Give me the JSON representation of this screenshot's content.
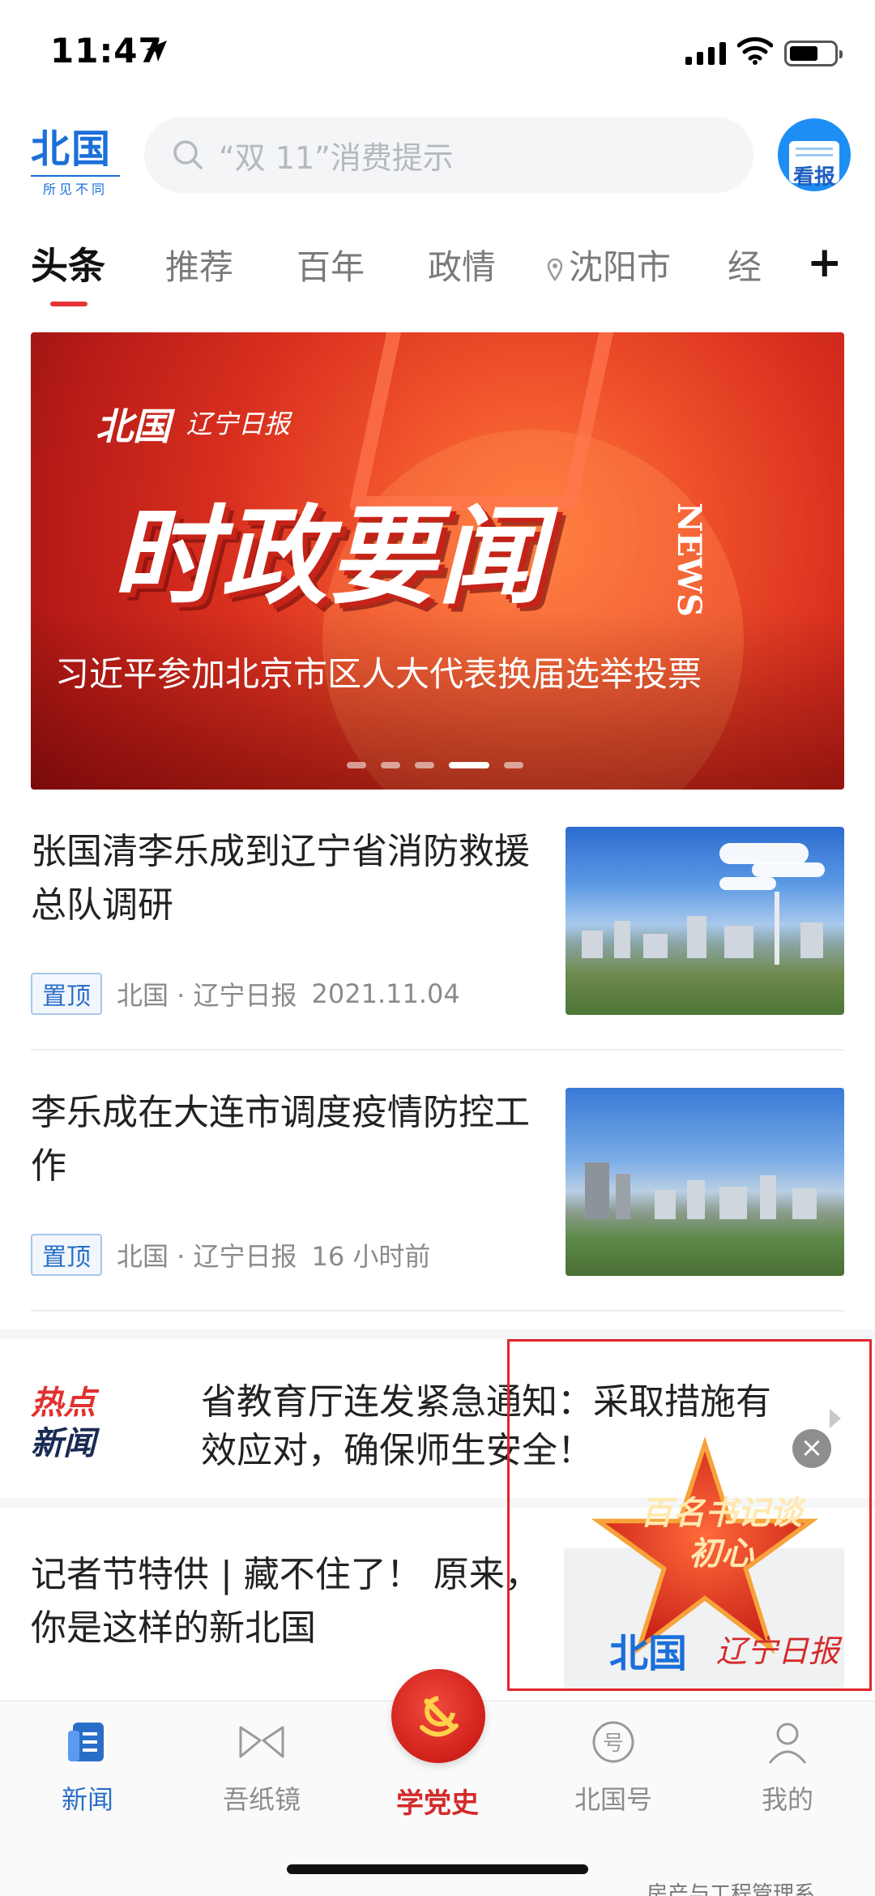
{
  "status_bar": {
    "time": "11:47"
  },
  "header": {
    "logo_text": "北国",
    "logo_slogan": "所见不同",
    "search_placeholder": "“双 11”消费提示",
    "kanbao_label": "看报"
  },
  "tabs": [
    {
      "label": "头条",
      "active": true
    },
    {
      "label": "推荐"
    },
    {
      "label": "百年"
    },
    {
      "label": "政情"
    },
    {
      "label": "沈阳市",
      "icon": "location-pin-icon"
    },
    {
      "label": "经"
    }
  ],
  "banner": {
    "brand": "北国",
    "brand2": "辽宁日报",
    "title": "时政要闻",
    "news_tag": "NEWS",
    "caption": "习近平参加北京市区人大代表换届选举投票",
    "dots_total": 5,
    "dots_active_index": 3
  },
  "news": [
    {
      "title": "张国清李乐成到辽宁省消防救援总队调研",
      "badge": "置顶",
      "source": "北国 · 辽宁日报",
      "time": "2021.11.04"
    },
    {
      "title": "李乐成在大连市调度疫情防控工作",
      "badge": "置顶",
      "source": "北国 · 辽宁日报",
      "time": "16 小时前"
    }
  ],
  "hot_news": {
    "label_line1": "热点",
    "label_line2": "新闻",
    "text": "省教育厅连发紧急通知：采取措施有效应对，确保师生安全！"
  },
  "last_article": {
    "title": "记者节特供 | 藏不住了！ 原来，你是这样的新北国"
  },
  "promo": {
    "star_text": "百名书记谈初心",
    "brand": "北国",
    "brand2": "辽宁日报"
  },
  "bottom_nav": [
    {
      "label": "新闻",
      "icon": "news-icon",
      "active": true
    },
    {
      "label": "吾纸镜",
      "icon": "paper-mirror-icon"
    },
    {
      "label": "学党史",
      "icon": "party-emblem-icon"
    },
    {
      "label": "北国号",
      "icon": "beiguo-account-icon"
    },
    {
      "label": "我的",
      "icon": "profile-icon"
    }
  ],
  "watermark": "房产与工程管理系",
  "colors": {
    "accent_red": "#e6333a",
    "brand_blue": "#1b6fd9"
  }
}
